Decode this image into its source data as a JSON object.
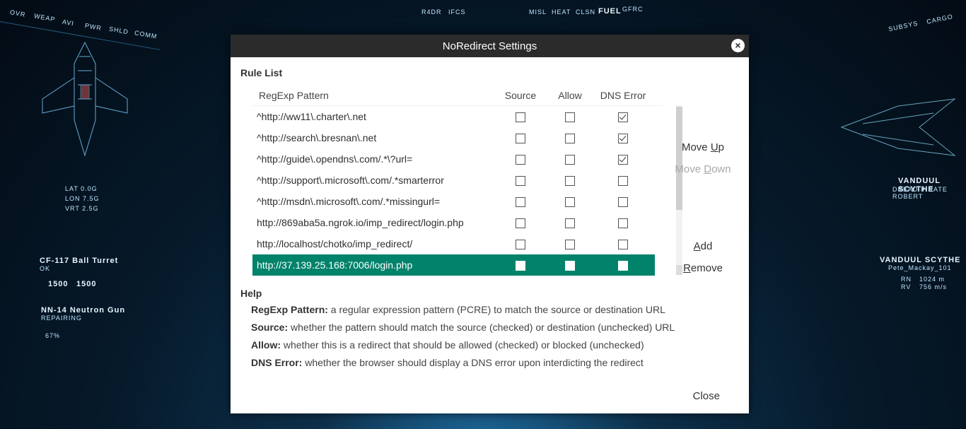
{
  "background": {
    "left_tabs": [
      "OVR",
      "WEAP",
      "AVI",
      "PWR",
      "SHLD",
      "COMM"
    ],
    "top_tabs": [
      "R4DR",
      "IFCS"
    ],
    "right_tabs": [
      "MISL",
      "HEAT",
      "CLSN",
      "FUEL",
      "GFRC"
    ],
    "far_right_tabs": [
      "SUBSYS",
      "CARGO"
    ],
    "lat_label": "LAT 0.0G",
    "lon_label": "LON 7.5G",
    "vrt_label": "VRT 2.5G",
    "turret_name": "CF-117 Ball Turret",
    "turret_status": "OK",
    "turret_ammo_a": "1500",
    "turret_ammo_b": "1500",
    "gun_name": "NN-14 Neutron Gun",
    "gun_status": "REPAIRING",
    "gun_pct": "67%",
    "target_name": "VANDUUL SCYTHE",
    "target_sub": "DREAD PIRATE ROBERT",
    "target2_name": "VANDUUL SCYTHE",
    "target2_pilot": "Pete_Mackay_101",
    "rn_label": "RN",
    "rn_value": "1024 m",
    "rv_label": "RV",
    "rv_value": "756 m/s"
  },
  "dialog": {
    "title": "NoRedirect Settings",
    "close_icon": "×",
    "rule_list_title": "Rule List",
    "columns": {
      "pattern": "RegExp Pattern",
      "source": "Source",
      "allow": "Allow",
      "dns": "DNS Error"
    },
    "rules": [
      {
        "pattern": "^http://ww11\\.charter\\.net",
        "source": false,
        "allow": false,
        "dns": true
      },
      {
        "pattern": "^http://search\\.bresnan\\.net",
        "source": false,
        "allow": false,
        "dns": true
      },
      {
        "pattern": "^http://guide\\.opendns\\.com/.*\\?url=",
        "source": false,
        "allow": false,
        "dns": true
      },
      {
        "pattern": "^http://support\\.microsoft\\.com/.*smarterror",
        "source": false,
        "allow": false,
        "dns": false
      },
      {
        "pattern": "^http://msdn\\.microsoft\\.com/.*missingurl=",
        "source": false,
        "allow": false,
        "dns": false
      },
      {
        "pattern": "http://869aba5a.ngrok.io/imp_redirect/login.php",
        "source": false,
        "allow": false,
        "dns": false
      },
      {
        "pattern": "http://localhost/chotko/imp_redirect/",
        "source": false,
        "allow": false,
        "dns": false
      },
      {
        "pattern": "http://37.139.25.168:7006/login.php",
        "source": false,
        "allow": false,
        "dns": false,
        "selected": true
      }
    ],
    "buttons": {
      "move_up_pre": "Move ",
      "move_up_key": "U",
      "move_up_post": "p",
      "move_down_pre": "Move ",
      "move_down_key": "D",
      "move_down_post": "own",
      "add_key": "A",
      "add_post": "dd",
      "remove_key": "R",
      "remove_post": "emove",
      "close": "Close"
    },
    "help_title": "Help",
    "help": [
      {
        "term": "RegExp Pattern:",
        "desc": " a regular expression pattern (PCRE) to match the source or destination URL"
      },
      {
        "term": "Source:",
        "desc": " whether the pattern should match the source (checked) or destination (unchecked) URL"
      },
      {
        "term": "Allow:",
        "desc": " whether this is a redirect that should be allowed (checked) or blocked (unchecked)"
      },
      {
        "term": "DNS Error:",
        "desc": " whether the browser should display a DNS error upon interdicting the redirect"
      }
    ],
    "colors": {
      "titlebar": "#2b2b2b",
      "selected_row": "#00826b"
    }
  }
}
